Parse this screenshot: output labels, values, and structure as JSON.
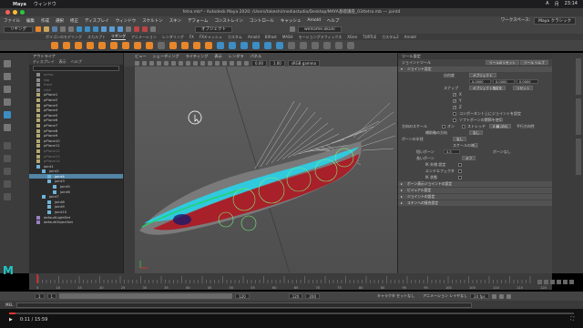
{
  "mac_menubar": {
    "app": "Maya",
    "menu": "ウィンドウ",
    "right_items": [
      "A",
      "月",
      "23:14"
    ]
  },
  "window_title": "fetra.mb* - Autodesk Maya 2020: /Users/takeshi/mediastudio/Desktop/MAYA基礎講座_03/tetra.mb  ---  joint4",
  "main_menu": [
    "ファイル",
    "編集",
    "作成",
    "選択",
    "修正",
    "ディスプレイ",
    "ウィンドウ",
    "スケルトン",
    "スキン",
    "デフォーム",
    "コンストレイン",
    "コントロール",
    "キャッシュ",
    "Arnold",
    "ヘルプ"
  ],
  "workspace": {
    "label": "ワークスペース:",
    "value": "Maya クラシック"
  },
  "status_line": {
    "mode": "リギング",
    "camera": "オブジェクト",
    "account": "welcome.okuni"
  },
  "shelf_tabs": [
    "ポリゴンのモデリング",
    "スカルプト",
    "リギング",
    "アニメーション",
    "レンダリング",
    "FX",
    "FXキャッシュ",
    "カスタム",
    "Arnold",
    "Bifrost",
    "MASH",
    "モーショングラフィックス",
    "XGen",
    "TURTLE",
    "カスタム2",
    "Arnold"
  ],
  "outliner": {
    "title": "アウトライナ",
    "menu": [
      "ディスプレイ",
      "表示",
      "ヘルプ"
    ],
    "search_placeholder": "",
    "items": [
      {
        "label": "persp",
        "indent": 0,
        "type": "camera",
        "state": "dim"
      },
      {
        "label": "top",
        "indent": 0,
        "type": "camera",
        "state": "dim"
      },
      {
        "label": "front",
        "indent": 0,
        "type": "camera",
        "state": "dim"
      },
      {
        "label": "side",
        "indent": 0,
        "type": "camera",
        "state": "dim"
      },
      {
        "label": "pPlane1",
        "indent": 0,
        "type": "mesh",
        "state": "normal"
      },
      {
        "label": "pPlane2",
        "indent": 0,
        "type": "mesh",
        "state": "normal"
      },
      {
        "label": "pPlane3",
        "indent": 0,
        "type": "mesh",
        "state": "normal"
      },
      {
        "label": "pPlane4",
        "indent": 0,
        "type": "mesh",
        "state": "normal"
      },
      {
        "label": "pPlane5",
        "indent": 0,
        "type": "mesh",
        "state": "normal"
      },
      {
        "label": "pPlane6",
        "indent": 0,
        "type": "mesh",
        "state": "normal"
      },
      {
        "label": "pPlane7",
        "indent": 0,
        "type": "mesh",
        "state": "normal"
      },
      {
        "label": "pPlane8",
        "indent": 0,
        "type": "mesh",
        "state": "normal"
      },
      {
        "label": "pPlane9",
        "indent": 0,
        "type": "mesh",
        "state": "normal"
      },
      {
        "label": "pPlane10",
        "indent": 0,
        "type": "mesh",
        "state": "normal"
      },
      {
        "label": "pPlane11",
        "indent": 0,
        "type": "mesh",
        "state": "normal"
      },
      {
        "label": "pPlane12",
        "indent": 0,
        "type": "mesh",
        "state": "dim"
      },
      {
        "label": "pPlane13",
        "indent": 0,
        "type": "mesh",
        "state": "dim"
      },
      {
        "label": "pPlane14",
        "indent": 0,
        "type": "mesh",
        "state": "dim"
      },
      {
        "label": "joint1",
        "indent": 0,
        "type": "joint",
        "state": "normal"
      },
      {
        "label": "joint2",
        "indent": 1,
        "type": "joint",
        "state": "normal"
      },
      {
        "label": "joint4",
        "indent": 2,
        "type": "joint",
        "state": "selected"
      },
      {
        "label": "joint3",
        "indent": 2,
        "type": "joint",
        "state": "normal"
      },
      {
        "label": "joint5",
        "indent": 3,
        "type": "joint",
        "state": "normal"
      },
      {
        "label": "joint6",
        "indent": 3,
        "type": "joint",
        "state": "normal"
      },
      {
        "label": "joint7",
        "indent": 1,
        "type": "joint",
        "state": "normal"
      },
      {
        "label": "joint8",
        "indent": 2,
        "type": "joint",
        "state": "normal"
      },
      {
        "label": "joint9",
        "indent": 2,
        "type": "joint",
        "state": "normal"
      },
      {
        "label": "joint10",
        "indent": 2,
        "type": "joint",
        "state": "normal"
      },
      {
        "label": "defaultLightSet",
        "indent": 0,
        "type": "set",
        "state": "normal"
      },
      {
        "label": "defaultObjectSet",
        "indent": 0,
        "type": "set",
        "state": "normal"
      }
    ]
  },
  "viewport": {
    "menu": [
      "ビュー",
      "シェーディング",
      "ライティング",
      "表示",
      "レンダラ",
      "パネル"
    ],
    "num1": "0.00",
    "num2": "1.00",
    "colorspace": "sRGB gamma",
    "footer": "persp"
  },
  "attribute_editor": {
    "header": "ツール設定",
    "tool_name": "ジョイントツール",
    "reset_button": "ツールのリセット",
    "help_button": "ツール ヘルプ",
    "section_main": "ジョイント設定",
    "dof_label": "自由度",
    "dof_value": "オブジェクト",
    "field_x": "0.0000",
    "field_y": "0.0000",
    "field_z": "0.0000",
    "snap_label": "スナップ",
    "snap_btn1": "オブジェクト指定を",
    "snap_btn2": "リセット",
    "checks": [
      {
        "label": "X",
        "checked": true
      },
      {
        "label": "Y",
        "checked": true
      },
      {
        "label": "Z",
        "checked": true
      },
      {
        "label": "コンポーネント上にジョイントを設定",
        "checked": false
      },
      {
        "label": "ソフトボーンの関節を使用",
        "checked": false
      }
    ],
    "orient_label": "方向のスケール",
    "orient_options": [
      "オン",
      "ストレッチ",
      "X 軸 (ZX)",
      "平行方向性"
    ],
    "secondary_label": "補助軸の方向",
    "secondary_value": "なし",
    "bone_label": "ボーンの半径",
    "bone_value": "なし",
    "scale_label": "スケールの補正",
    "short_bone_label": "短いボーン",
    "short_bone_value": "0.5",
    "short_bone_opt": "ボーンなし",
    "long_bone_label": "長いボーン",
    "long_bone_opt": "オフ",
    "bone_radius_label": "ボーン半径",
    "extra": [
      "IK 外側 設定",
      "エンドエフェクタ",
      "IK 状態"
    ],
    "sections": [
      "ボーン表示ジョイントの設定",
      "ビジュアル設定",
      "ジョイントの設定",
      "スキンへの接合設定"
    ]
  },
  "timeline": {
    "ticks": [
      "5",
      "10",
      "15",
      "20",
      "25",
      "30",
      "35",
      "40",
      "45",
      "50",
      "55",
      "60",
      "65",
      "70",
      "75",
      "80",
      "85",
      "90",
      "95",
      "100",
      "105",
      "110",
      "115",
      "120"
    ],
    "current_frame": "1"
  },
  "range": {
    "start": "1",
    "inner_start": "1",
    "inner_end": "120",
    "end": "120",
    "anim_end": "200",
    "character_set": "キャラクタ セットなし",
    "anim_layer": "アニメーション レイヤなし",
    "fps": "24 fps"
  },
  "command_line": {
    "label": "MEL"
  },
  "video": {
    "time": "0:11 / 15:59",
    "progress": 0.012
  },
  "logo": "M",
  "colors": {
    "accent": "#5285a6",
    "maya_teal": "#1ec7c3",
    "shelf_orange": "#e8862a"
  }
}
